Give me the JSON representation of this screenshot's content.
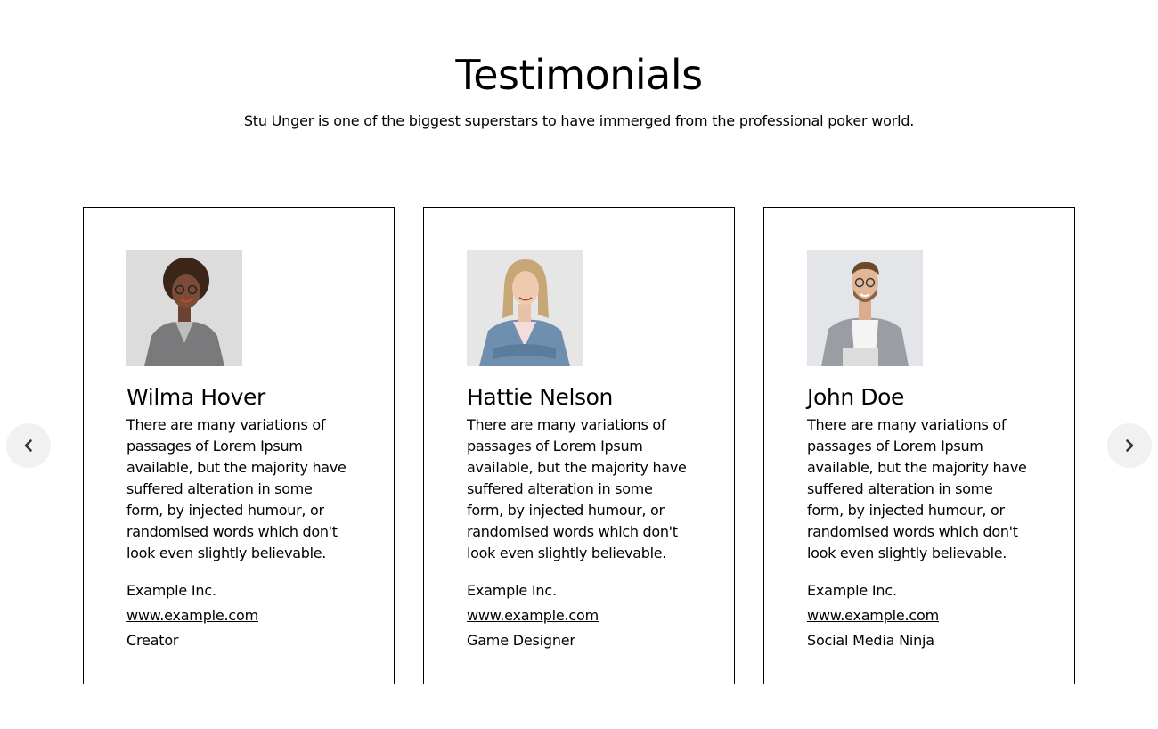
{
  "section": {
    "title": "Testimonials",
    "subtitle": "Stu Unger is one of the biggest superstars to have immerged from the professional poker world."
  },
  "nav": {
    "prev_icon": "chevron-left-icon",
    "next_icon": "chevron-right-icon"
  },
  "testimonials": [
    {
      "name": "Wilma Hover",
      "quote": "There are many variations of passages of Lorem Ipsum available, but the majority have suffered alteration in some form, by injected humour, or randomised words which don't look even slightly believable.",
      "company": "Example Inc.",
      "website": "www.example.com",
      "role": "Creator"
    },
    {
      "name": "Hattie Nelson",
      "quote": "There are many variations of passages of Lorem Ipsum available, but the majority have suffered alteration in some form, by injected humour, or randomised words which don't look even slightly believable.",
      "company": "Example Inc.",
      "website": "www.example.com",
      "role": "Game Designer"
    },
    {
      "name": "John Doe",
      "quote": "There are many variations of passages of Lorem Ipsum available, but the majority have suffered alteration in some form, by injected humour, or randomised words which don't look even slightly believable.",
      "company": "Example Inc.",
      "website": "www.example.com",
      "role": "Social Media Ninja"
    }
  ],
  "colors": {
    "background": "#ffffff",
    "text": "#000000",
    "card_border": "#000000",
    "nav_button_bg": "#f1f1f1",
    "nav_icon": "#333333"
  }
}
